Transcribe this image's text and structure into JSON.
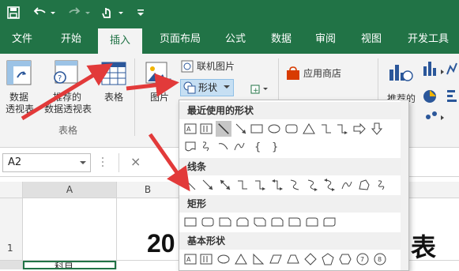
{
  "qat": {
    "save_icon": "save-icon",
    "undo_icon": "undo-icon",
    "redo_icon": "redo-icon",
    "touch_icon": "touch-mode-icon",
    "customize_icon": "customize-qat-icon"
  },
  "tabs": [
    "文件",
    "开始",
    "插入",
    "页面布局",
    "公式",
    "数据",
    "审阅",
    "视图",
    "开发工具"
  ],
  "ribbon": {
    "pivot_label_1": "数据",
    "pivot_label_2": "透视表",
    "recommended_label_1": "推荐的",
    "recommended_label_2": "数据透视表",
    "table_label": "表格",
    "group_tables": "表格",
    "picture_label": "图片",
    "online_pictures": "联机图片",
    "shapes": "形状",
    "app_store": "应用商店",
    "recommended_charts_partial": "推荐的"
  },
  "formula_bar": {
    "name_box": "A2",
    "cancel_icon": "×"
  },
  "grid": {
    "col_a": "A",
    "col_b": "B",
    "row_1": "1",
    "title_left": "20",
    "title_right": "表",
    "cell_a2_partial": "科目"
  },
  "shapes_menu": {
    "recent": "最近使用的形状",
    "lines": "线条",
    "rectangles": "矩形",
    "basic": "基本形状"
  },
  "colors": {
    "excel_green": "#217346",
    "ribbon_bg": "#f3f3f3",
    "arrow_red": "#e23a3a",
    "grid_line": "#d4d4d4"
  }
}
